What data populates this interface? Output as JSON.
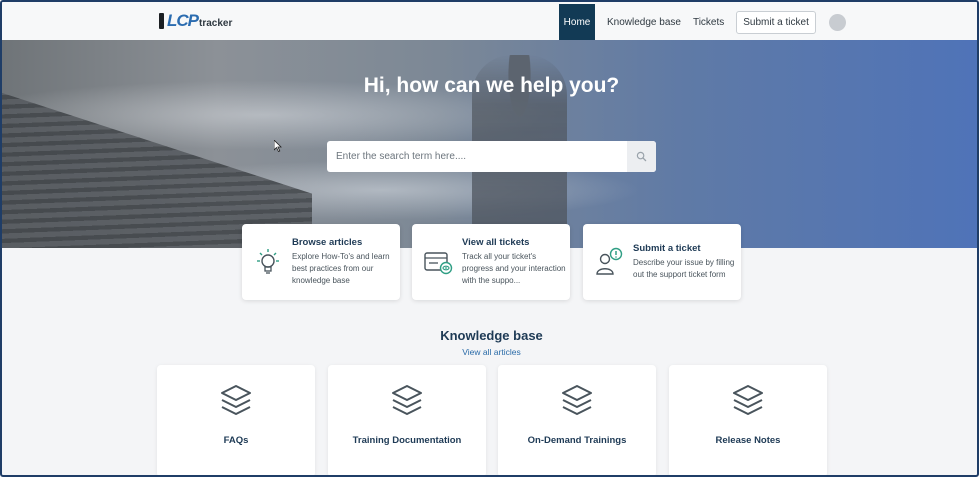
{
  "brand": {
    "logo_text": "LCP",
    "logo_sub": "tracker"
  },
  "nav": {
    "home": "Home",
    "knowledge_base": "Knowledge base",
    "tickets": "Tickets",
    "submit_ticket": "Submit a ticket"
  },
  "hero": {
    "title": "Hi, how can we help you?",
    "search_placeholder": "Enter the search term here...."
  },
  "features": [
    {
      "title": "Browse articles",
      "desc": "Explore How-To's and learn best practices from our knowledge base",
      "icon": "lightbulb-icon"
    },
    {
      "title": "View all tickets",
      "desc": "Track all your ticket's progress and your interaction with the suppo...",
      "icon": "tickets-icon"
    },
    {
      "title": "Submit a ticket",
      "desc": "Describe your issue by filling out the support ticket form",
      "icon": "user-alert-icon"
    }
  ],
  "knowledge_base": {
    "title": "Knowledge base",
    "view_all": "View all articles",
    "categories": [
      {
        "label": "FAQs",
        "icon": "layers-icon"
      },
      {
        "label": "Training Documentation",
        "icon": "layers-icon"
      },
      {
        "label": "On-Demand Trainings",
        "icon": "layers-icon"
      },
      {
        "label": "Release Notes",
        "icon": "layers-icon"
      }
    ]
  },
  "colors": {
    "nav_active": "#123a55",
    "accent": "#2a6ba8",
    "icon": "#49545c",
    "icon_accent": "#2f9e84"
  }
}
